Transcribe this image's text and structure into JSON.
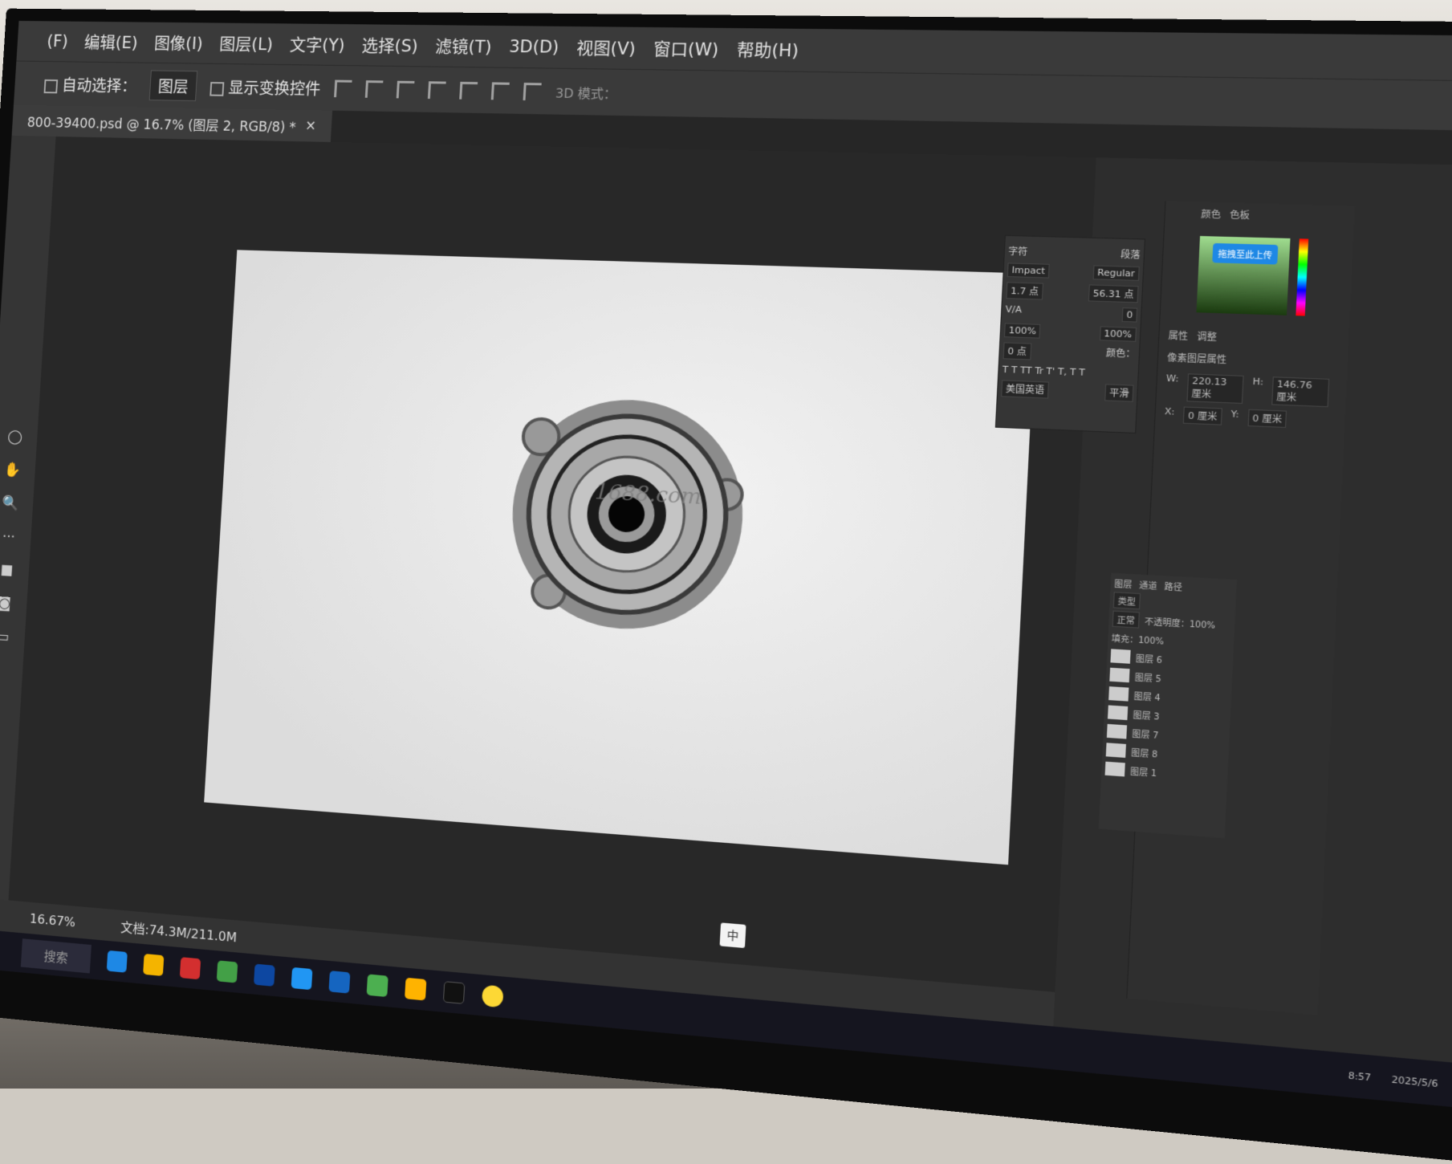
{
  "menu": [
    "(F)",
    "编辑(E)",
    "图像(I)",
    "图层(L)",
    "文字(Y)",
    "选择(S)",
    "滤镜(T)",
    "3D(D)",
    "视图(V)",
    "窗口(W)",
    "帮助(H)"
  ],
  "options": {
    "auto_select": "自动选择：",
    "layer_select": "图层",
    "show_transform": "显示变换控件",
    "mode_3d": "3D 模式："
  },
  "document_tab": {
    "title": "800-39400.psd @ 16.7% (图层 2, RGB/8) *",
    "close": "×"
  },
  "canvas": {
    "watermark": "1688.com"
  },
  "character_panel": {
    "tabs": [
      "字符",
      "段落"
    ],
    "font": "Impact",
    "style": "Regular",
    "size": "1.7 点",
    "leading": "56.31 点",
    "tracking": "0",
    "scale_v": "100%",
    "scale_h": "100%",
    "baseline": "0 点",
    "color_label": "颜色：",
    "language": "美国英语",
    "aa": "平滑"
  },
  "right_panel": {
    "tabs": [
      "颜色",
      "色板"
    ],
    "props_tabs": [
      "属性",
      "调整"
    ],
    "upload_badge": "拖拽至此上传",
    "prop_title": "像素图层属性",
    "w": "220.13 厘米",
    "h": "146.76 厘米",
    "x": "0 厘米",
    "y": "0 厘米"
  },
  "layers_panel": {
    "tabs": [
      "图层",
      "通道",
      "路径"
    ],
    "kind": "类型",
    "blend": "正常",
    "opacity": "不透明度：100%",
    "fill": "填充：100%",
    "layers": [
      "图层 6",
      "图层 5",
      "图层 4",
      "图层 3",
      "图层 7",
      "图层 8",
      "图层 1"
    ]
  },
  "status": {
    "zoom": "16.67%",
    "doc": "文档:74.3M/211.0M"
  },
  "taskbar": {
    "search": "搜索",
    "clock_time": "8:57",
    "clock_date": "2025/5/6"
  },
  "ime": {
    "label": "中"
  }
}
